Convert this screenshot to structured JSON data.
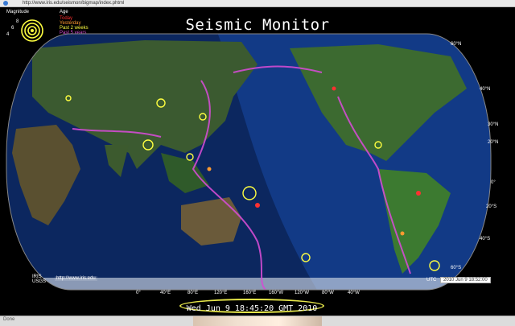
{
  "browser": {
    "url": "http://www.iris.edu/seismon/bigmap/index.phtml",
    "status": "Done"
  },
  "title": "Seismic Monitor",
  "legend": {
    "magnitude_label": "Magnitude",
    "age_label": "Age",
    "ages": [
      {
        "label": "Today",
        "color": "#ff3030"
      },
      {
        "label": "Yesterday",
        "color": "#ff9a30"
      },
      {
        "label": "Past 2 weeks",
        "color": "#ffff40"
      },
      {
        "label": "Past 5 years",
        "color": "#d34cd3"
      }
    ],
    "magnitudes": [
      "8",
      "6",
      "4"
    ]
  },
  "map": {
    "lat_labels": [
      "60°N",
      "40°N",
      "30°N",
      "20°N",
      "0°",
      "20°S",
      "40°S",
      "60°S"
    ],
    "lon_labels": [
      "0°",
      "40°E",
      "80°E",
      "120°E",
      "160°E",
      "160°W",
      "120°W",
      "80°W",
      "40°W"
    ]
  },
  "footer": {
    "left_label": "IRIS",
    "left_url": "http://www.iris.edu",
    "left_label2": "USGS",
    "utc_label": "UTC",
    "utc_value": "2010 Jun 9 18:52:00"
  },
  "timestamp": "Wed Jun  9 18:45:20 GMT 2010"
}
